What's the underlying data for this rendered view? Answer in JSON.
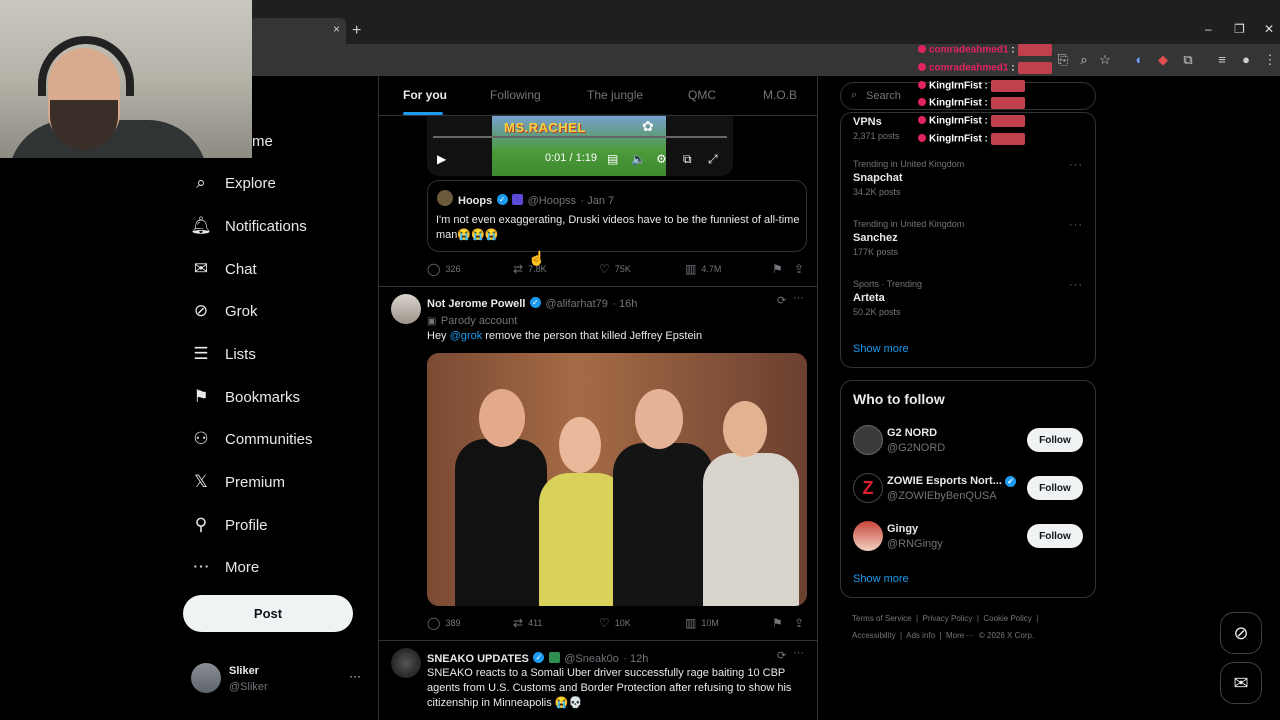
{
  "browser": {
    "tab_close": "×",
    "new_tab": "+",
    "minimize": "–",
    "restore": "❐",
    "close": "✕"
  },
  "stream_chat": [
    {
      "user": "comradeahmed1",
      "color": "#e0245e"
    },
    {
      "user": "comradeahmed1",
      "color": "#e0245e"
    },
    {
      "user": "KingIrnFist",
      "color": "#ffffff"
    },
    {
      "user": "KingIrnFist",
      "color": "#ffffff"
    },
    {
      "user": "KingIrnFist",
      "color": "#ffffff"
    },
    {
      "user": "KingIrnFist",
      "color": "#ffffff"
    }
  ],
  "nav": {
    "home_partial": "me",
    "items": [
      {
        "label": "Explore",
        "icon": "search-icon"
      },
      {
        "label": "Notifications",
        "icon": "bell-icon"
      },
      {
        "label": "Chat",
        "icon": "mail-icon"
      },
      {
        "label": "Grok",
        "icon": "grok-icon"
      },
      {
        "label": "Lists",
        "icon": "list-icon"
      },
      {
        "label": "Bookmarks",
        "icon": "bookmark-icon"
      },
      {
        "label": "Communities",
        "icon": "people-icon"
      },
      {
        "label": "Premium",
        "icon": "x-logo-icon"
      },
      {
        "label": "Profile",
        "icon": "person-icon"
      },
      {
        "label": "More",
        "icon": "more-circle-icon"
      }
    ],
    "post_label": "Post",
    "account": {
      "name": "Sliker",
      "handle": "@Sliker",
      "more": "···"
    }
  },
  "feed_tabs": [
    "For you",
    "Following",
    "The jungle",
    "QMC",
    "M.O.B"
  ],
  "tweets": [
    {
      "video": {
        "title": "MS.RACHEL",
        "time": "0:01 / 1:19"
      },
      "quote": {
        "name": "Hoops",
        "handle": "@Hoopss",
        "date": "· Jan 7",
        "text": "I'm not even exaggerating, Druski videos have to be the funniest of all-time man😭😭😭"
      },
      "stats": {
        "replies": "326",
        "reposts": "7.8K",
        "likes": "75K",
        "views": "4.7M"
      }
    },
    {
      "name": "Not Jerome Powell",
      "handle": "@alifarhat79",
      "time": "· 16h",
      "label": "Parody account",
      "text_mention": "@grok",
      "text_before": "Hey ",
      "text_after": " remove the person that killed Jeffrey Epstein",
      "stats": {
        "replies": "389",
        "reposts": "411",
        "likes": "10K",
        "views": "10M"
      }
    },
    {
      "name": "SNEAKO UPDATES",
      "handle": "@Sneak0o",
      "time": "· 12h",
      "text": "SNEAKO reacts to a Somali Uber driver successfully rage baiting 10 CBP agents from U.S. Customs and Border Protection after refusing to show his citizenship in Minneapolis 😭💀"
    }
  ],
  "search": {
    "placeholder": "Search"
  },
  "trends": [
    {
      "context": "",
      "name": "VPNs",
      "count": "2,371 posts"
    },
    {
      "context": "Trending in United Kingdom",
      "name": "Snapchat",
      "count": "34.2K posts"
    },
    {
      "context": "Trending in United Kingdom",
      "name": "Sanchez",
      "count": "177K posts"
    },
    {
      "context": "Sports · Trending",
      "name": "Arteta",
      "count": "50.2K posts"
    }
  ],
  "trends_show_more": "Show more",
  "who_to_follow": {
    "title": "Who to follow",
    "accounts": [
      {
        "name": "G2 NORD",
        "handle": "@G2NORD",
        "button": "Follow"
      },
      {
        "name": "ZOWIE Esports Nort...",
        "handle": "@ZOWIEbyBenQUSA",
        "button": "Follow"
      },
      {
        "name": "Gingy",
        "handle": "@RNGingy",
        "button": "Follow"
      }
    ],
    "show_more": "Show more"
  },
  "footer": {
    "line1": [
      "Terms of Service",
      "|",
      "Privacy Policy",
      "|",
      "Cookie Policy",
      "|"
    ],
    "line2": [
      "Accessibility",
      "|",
      "Ads info",
      "|",
      "More ···",
      "© 2026 X Corp."
    ]
  }
}
